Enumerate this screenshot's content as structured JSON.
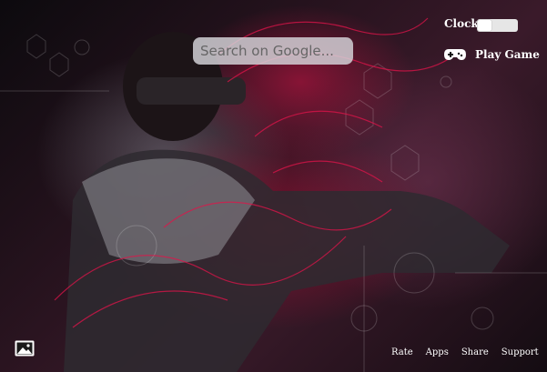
{
  "search": {
    "placeholder": "Search on Google..."
  },
  "widgets": {
    "clock_label": "Clock",
    "play_label": "Play Game",
    "clock_toggle_on": false
  },
  "footer": {
    "links": [
      "Rate",
      "Apps",
      "Share",
      "Support"
    ]
  },
  "icons": {
    "gamepad": "gamepad-icon",
    "background": "image-icon"
  },
  "colors": {
    "accent": "#e0144a",
    "text": "#ffffff"
  }
}
